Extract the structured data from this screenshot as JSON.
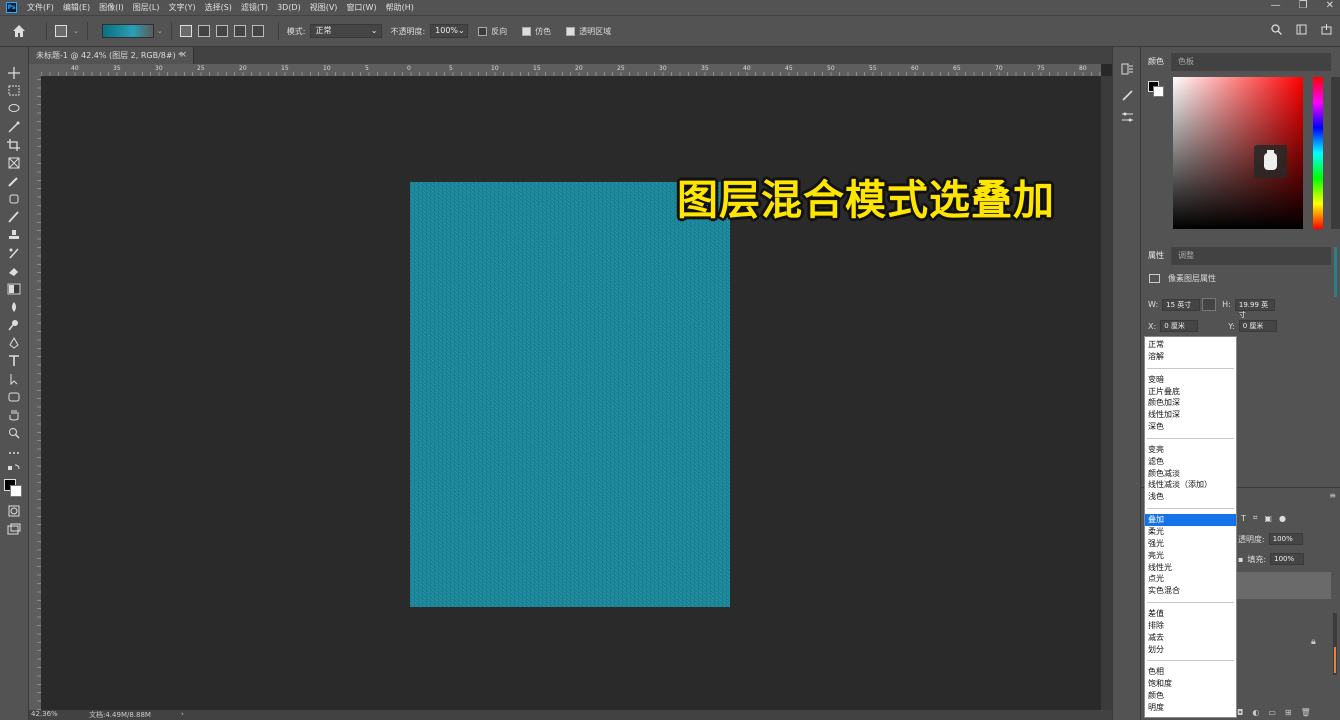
{
  "menubar": {
    "app_icon": "Ps",
    "items": [
      "文件(F)",
      "编辑(E)",
      "图像(I)",
      "图层(L)",
      "文字(Y)",
      "选择(S)",
      "滤镜(T)",
      "3D(D)",
      "视图(V)",
      "窗口(W)",
      "帮助(H)"
    ],
    "window_controls": [
      "—",
      "❐",
      "✕"
    ]
  },
  "options": {
    "mode_label": "模式:",
    "mode_value": "正常",
    "opacity_label": "不透明度:",
    "opacity_value": "100%",
    "reverse_label": "反向",
    "dither_label": "仿色",
    "transparency_label": "透明区域",
    "gradient_colors": [
      "#0c6f80",
      "#2a9fb5"
    ]
  },
  "document": {
    "tab_title": "未标题-1 @ 42.4% (图层 2, RGB/8#) *",
    "close": "×",
    "canvas_color": "#1a8ea3",
    "ruler_labels": [
      "40",
      "35",
      "30",
      "25",
      "20",
      "15",
      "10",
      "5",
      "0",
      "5",
      "10",
      "15",
      "20",
      "25",
      "30",
      "35",
      "40",
      "45",
      "50",
      "55",
      "60",
      "65",
      "70",
      "75",
      "80"
    ]
  },
  "caption": "图层混合模式选叠加",
  "status": {
    "zoom": "42.36%",
    "doc_info": "文档:4.49M/8.88M",
    "arrow": "›"
  },
  "color_panel": {
    "tabs": [
      "颜色",
      "色板"
    ],
    "foreground": "#000000",
    "background": "#ffffff"
  },
  "properties_panel": {
    "tabs": [
      "属性",
      "调整"
    ],
    "title": "像素图层属性",
    "w_label": "W:",
    "w_value": "15 英寸",
    "h_label": "H:",
    "h_value": "19.99 英寸",
    "x_label": "X:",
    "x_value": "0 厘米",
    "y_label": "Y:",
    "y_value": "0 厘米"
  },
  "blend_dropdown": {
    "groups": [
      [
        "正常",
        "溶解"
      ],
      [
        "变暗",
        "正片叠底",
        "颜色加深",
        "线性加深",
        "深色"
      ],
      [
        "变亮",
        "滤色",
        "颜色减淡",
        "线性减淡（添加）",
        "浅色"
      ],
      [
        "叠加",
        "柔光",
        "强光",
        "亮光",
        "线性光",
        "点光",
        "实色混合"
      ],
      [
        "差值",
        "排除",
        "减去",
        "划分"
      ],
      [
        "色相",
        "饱和度",
        "颜色",
        "明度"
      ]
    ],
    "selected": "叠加"
  },
  "layers_panel": {
    "opacity_label": "透明度:",
    "opacity_value": "100%",
    "fill_label": "填充:",
    "fill_value": "100%"
  }
}
